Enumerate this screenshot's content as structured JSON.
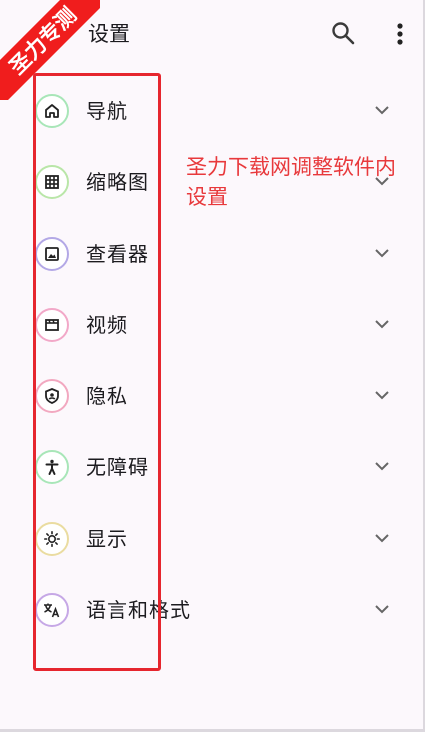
{
  "header": {
    "title": "设置",
    "search_icon": "search-icon",
    "more_icon": "more-vertical-icon"
  },
  "watermark": {
    "text": "圣力专测",
    "color": "#f01d1d"
  },
  "settings": {
    "items": [
      {
        "label": "导航",
        "icon": "home-icon",
        "ring_color": "#a8e6b8"
      },
      {
        "label": "缩略图",
        "icon": "grid-icon",
        "ring_color": "#b9e6a8"
      },
      {
        "label": "查看器",
        "icon": "image-icon",
        "ring_color": "#b3a8e6"
      },
      {
        "label": "视频",
        "icon": "movie-icon",
        "ring_color": "#f2a8c8"
      },
      {
        "label": "隐私",
        "icon": "privacy-shield-icon",
        "ring_color": "#f2a8c0"
      },
      {
        "label": "无障碍",
        "icon": "accessibility-icon",
        "ring_color": "#a8e6b8"
      },
      {
        "label": "显示",
        "icon": "brightness-icon",
        "ring_color": "#eadca0"
      },
      {
        "label": "语言和格式",
        "icon": "translate-icon",
        "ring_color": "#c6a8e6"
      }
    ]
  },
  "annotation": {
    "text": "圣力下载网调整软件内设置",
    "color": "#e8393c",
    "box_color": "#e6262e"
  }
}
